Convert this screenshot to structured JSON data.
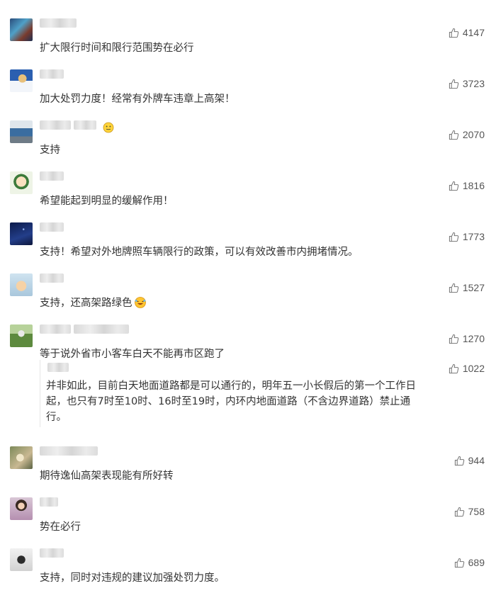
{
  "comments": [
    {
      "text": "扩大限行时间和限行范围势在必行",
      "likes": "4147"
    },
    {
      "text": "加大处罚力度！经常有外牌车违章上高架！",
      "likes": "3723"
    },
    {
      "text": "支持",
      "likes": "2070"
    },
    {
      "text": "希望能起到明显的缓解作用！",
      "likes": "1816"
    },
    {
      "text": "支持！希望对外地牌照车辆限行的政策，可以有效改善市内拥堵情况。",
      "likes": "1773"
    },
    {
      "text": "支持，还高架路绿色",
      "likes": "1527"
    },
    {
      "text": "等于说外省市小客车白天不能再市区跑了",
      "likes": "1270"
    },
    {
      "text": "期待逸仙高架表现能有所好转",
      "likes": "944"
    },
    {
      "text": "势在必行",
      "likes": "758"
    },
    {
      "text": "支持，同时对违规的建议加强处罚力度。",
      "likes": "689"
    }
  ],
  "reply": {
    "likes": "1022",
    "lines": [
      "并非如此，目前白天地面道路都是可以通行的，明年五一小长假后的第一个工作日",
      "起，也只有7时至10时、16时至19时，内环内地面道路（不含边界道路）禁止通",
      "行。"
    ]
  },
  "icons": {
    "like": "thumbs-up-icon",
    "emoji_smile": "smile-emoji-icon",
    "emoji_laugh": "laugh-emoji-icon"
  },
  "colors": {
    "text": "#333333",
    "count": "#555555",
    "icon": "#777777"
  }
}
